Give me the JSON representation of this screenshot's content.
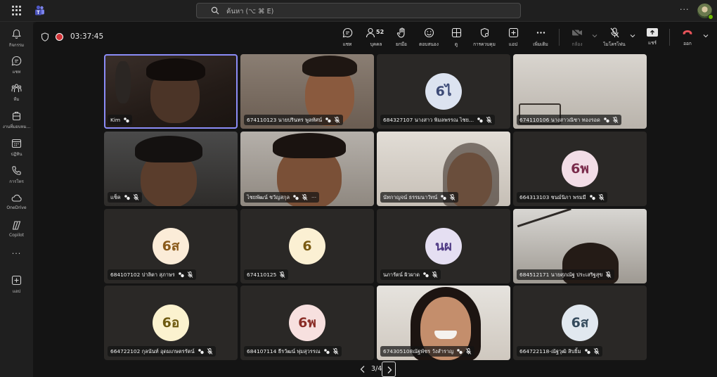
{
  "top_bar": {
    "search_placeholder": "ค้นหา (⌥ ⌘ E)",
    "more_label": "···"
  },
  "rail": {
    "items": [
      {
        "label": "กิจกรรม",
        "icon": "bell-icon"
      },
      {
        "label": "แชท",
        "icon": "chat-icon"
      },
      {
        "label": "ทีม",
        "icon": "teams-icon"
      },
      {
        "label": "งานที่มอบหม...",
        "icon": "assignments-icon"
      },
      {
        "label": "ปฏิทิน",
        "icon": "calendar-icon"
      },
      {
        "label": "การโทร",
        "icon": "phone-icon"
      },
      {
        "label": "OneDrive",
        "icon": "cloud-icon"
      },
      {
        "label": "Copilot",
        "icon": "copilot-icon"
      }
    ],
    "more_label": "···",
    "apps_label": "แอป"
  },
  "meeting": {
    "timer": "03:37:45",
    "toolbar": {
      "chat": "แชท",
      "people": "บุคคล",
      "people_count": "52",
      "raise": "ยกมือ",
      "react": "ตอบสนอง",
      "view": "ดู",
      "controls": "การควบคุม",
      "apps": "แอป",
      "more": "เพิ่มเติม",
      "camera": "กล้อง",
      "mic": "ไมโครโฟน",
      "share": "แชร์",
      "leave": "ออก"
    },
    "tiles": [
      {
        "name": "Kim",
        "avatar": "",
        "active": true
      },
      {
        "name": "674110123 นายปรินทร พูลทัศน์",
        "avatar": ""
      },
      {
        "name": "684327107 นางสาว พิมลพรรณ ไชย...",
        "avatar": "6ไ",
        "avatar_bg": "#dce3f0",
        "avatar_fg": "#3c4a76"
      },
      {
        "name": "674110106 นางสาวณิชา ทองรอด",
        "avatar": ""
      },
      {
        "name": "แช็ค",
        "avatar": ""
      },
      {
        "name": "ไชยพัฒน์ ชวัญสกุล",
        "avatar": "",
        "more": "···"
      },
      {
        "name": "นัทกาญจน์ ธรรมนาวัทน์",
        "avatar": ""
      },
      {
        "name": "664313103 ชนม์นิภา พรมมี",
        "avatar": "6พ",
        "avatar_bg": "#f2dde6",
        "avatar_fg": "#7a2b4b"
      },
      {
        "name": "684107102 ปาลิตา สุภาษร",
        "avatar": "6ส",
        "avatar_bg": "#fbecd8",
        "avatar_fg": "#8a5a1a"
      },
      {
        "name": "674110125",
        "avatar": "6",
        "avatar_bg": "#fbf0d3",
        "avatar_fg": "#7a5a12"
      },
      {
        "name": "นภารัตน์ ผิวผาด",
        "avatar": "นผ",
        "avatar_bg": "#e5dff2",
        "avatar_fg": "#4f3a85"
      },
      {
        "name": "684512171 นายศุภณัฐ ประเสริฐสุข",
        "avatar": ""
      },
      {
        "name": "664722102 กุลนันท์ อุดมเกษตรรัตน์",
        "avatar": "6อ",
        "avatar_bg": "#fbf2cf",
        "avatar_fg": "#6e5a10"
      },
      {
        "name": "684107114 ธีรวัฒน์ พุ่มสุวรรณ",
        "avatar": "6พ",
        "avatar_bg": "#f7e0df",
        "avatar_fg": "#8a2d27"
      },
      {
        "name": "674305108ณัฐพัชร วังสำราญ",
        "avatar": ""
      },
      {
        "name": "664722118-ณัฐวุฒิ สิบยิ้ม",
        "avatar": "6ส",
        "avatar_bg": "#e1e8ef",
        "avatar_fg": "#344a5c"
      }
    ],
    "pager": "3/4"
  }
}
